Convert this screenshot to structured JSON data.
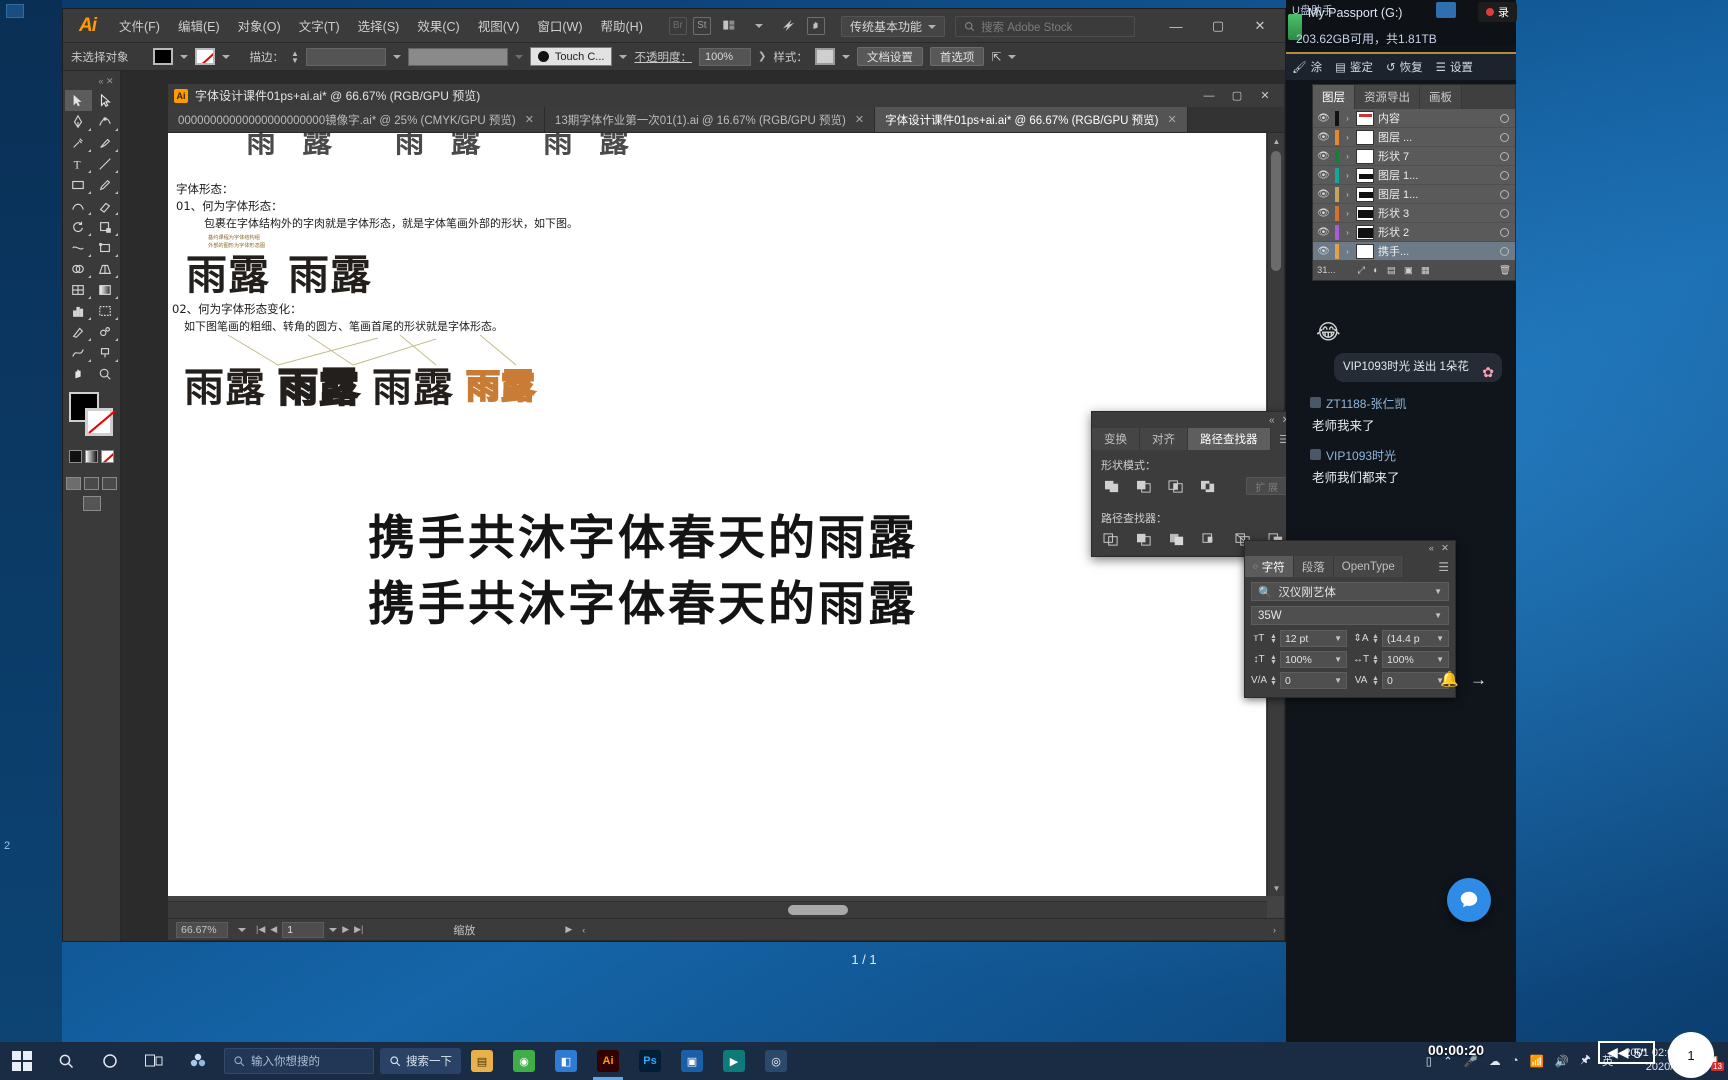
{
  "app": {
    "name": "Adobe Illustrator",
    "logo": "Ai",
    "menus": [
      "文件(F)",
      "编辑(E)",
      "对象(O)",
      "文字(T)",
      "选择(S)",
      "效果(C)",
      "视图(V)",
      "窗口(W)",
      "帮助(H)"
    ],
    "bridge_icon": "Br",
    "stock_icon": "St",
    "workspace": "传统基本功能",
    "search_placeholder": "搜索 Adobe Stock"
  },
  "control_bar": {
    "selection_status": "未选择对象",
    "stroke_label": "描边：",
    "brush_label": "Touch C...",
    "opacity_label": "不透明度：",
    "opacity_value": "100%",
    "style_label": "样式：",
    "doc_setup": "文档设置",
    "preferences": "首选项"
  },
  "document": {
    "title": "字体设计课件01ps+ai.ai* @ 66.67% (RGB/GPU 预览)",
    "tabs": [
      {
        "label": "00000000000000000000000镜像字.ai* @ 25% (CMYK/GPU 预览)",
        "active": false
      },
      {
        "label": "13期字体作业第一次01(1).ai @ 16.67% (RGB/GPU 预览)",
        "active": false
      },
      {
        "label": "字体设计课件01ps+ai.ai* @ 66.67% (RGB/GPU 预览)",
        "active": true
      }
    ],
    "status": {
      "zoom": "66.67%",
      "page": "1",
      "tool_name": "缩放"
    },
    "page_counter": "1 / 1"
  },
  "artboard": {
    "section1_title": "字体形态：",
    "section1_q": "01、何为字体形态：",
    "section1_a": "包裹在字体结构外的字肉就是字体形态，就是字体笔画外部的形状，如下图。",
    "sample_caption": "基约课程为字体结构组\n外部的图形为字体形态图",
    "sample1": "雨露",
    "sample2": "雨露",
    "section2_q": "02、何为字体形态变化：",
    "section2_a": "如下图笔画的粗细、转角的圆方、笔画首尾的形状就是字体形态。",
    "variants": [
      "雨露",
      "雨露",
      "雨露",
      "雨露"
    ],
    "headline1": "携手共沐字体春天的雨露",
    "headline2": "携手共沐字体春天的雨露"
  },
  "pathfinder_panel": {
    "tabs": [
      "变换",
      "对齐",
      "路径查找器"
    ],
    "active_tab": "路径查找器",
    "shape_modes_label": "形状模式：",
    "pathfinders_label": "路径查找器：",
    "expand_label": "扩 展"
  },
  "character_panel": {
    "tabs": [
      "字符",
      "段落",
      "OpenType"
    ],
    "active_tab": "字符",
    "font_family": "汉仪刚艺体",
    "font_style": "35W",
    "font_size": "12 pt",
    "leading": "(14.4 p",
    "vertical_scale": "100%",
    "horizontal_scale": "100%",
    "tracking": "0",
    "kerning": "0"
  },
  "layers_panel": {
    "tabs": [
      "图层",
      "资源导出",
      "画板"
    ],
    "active_tab": "图层",
    "rows": [
      {
        "name": "内容",
        "color": "#111111",
        "selected": false
      },
      {
        "name": "图层 ...",
        "color": "#e08a34",
        "selected": false
      },
      {
        "name": "形状 7",
        "color": "#1f7a3d",
        "selected": false
      },
      {
        "name": "图层 1...",
        "color": "#14a79a",
        "selected": false
      },
      {
        "name": "图层 1...",
        "color": "#c8a35a",
        "selected": false
      },
      {
        "name": "形状 3",
        "color": "#d4722c",
        "selected": false
      },
      {
        "name": "形状 2",
        "color": "#a95cd6",
        "selected": false
      },
      {
        "name": "携手...",
        "color": "#e3a24a",
        "selected": true
      }
    ],
    "footer_count": "31..."
  },
  "right_app": {
    "drive_title": "My Passport (G:)",
    "drive_info": "203.62GB可用，共1.81TB",
    "partial_label": "U盘助手",
    "tools": [
      "涂",
      "鉴定",
      "恢复",
      "设置"
    ],
    "tool_icons": [
      "brush-icon",
      "usb-icon",
      "restore-icon",
      "list-icon"
    ]
  },
  "chat": {
    "emoji": "😂",
    "gift": {
      "text": "VIP1093时光 送出 1朵花",
      "icon": "flower-icon"
    },
    "messages": [
      {
        "user": "ZT1188-张仁凯",
        "text": "老师我来了"
      },
      {
        "user": "VIP1093时光",
        "text": "老师我们都来了"
      }
    ]
  },
  "taskbar": {
    "search_placeholder": "输入你想搜的",
    "pill_label": "搜索一下",
    "apps": [
      {
        "name": "illustrator",
        "label": "Ai",
        "color": "#330000",
        "text_color": "#ff9a00",
        "active": true
      },
      {
        "name": "photoshop",
        "label": "Ps",
        "color": "#001e36",
        "text_color": "#31a8ff",
        "active": false
      },
      {
        "name": "media",
        "label": "▣",
        "color": "#1a5fa8",
        "text_color": "#ffffff",
        "active": false
      },
      {
        "name": "video",
        "label": "▶",
        "color": "#0e7a7a",
        "text_color": "#ffffff",
        "active": false
      },
      {
        "name": "browser",
        "label": "◎",
        "color": "#2b4a6b",
        "text_color": "#dfe8f2",
        "active": false
      }
    ],
    "clock_time": "2001 02:08:50",
    "clock_date": "2020/12/8",
    "input_method": "英",
    "badge_count": "13"
  },
  "recorder": {
    "elapsed": "00:00:20",
    "speed": "5\"",
    "speed_icon": "rewind-icon",
    "rec_label": "录"
  },
  "colors": {
    "accent_orange": "#ff9a00",
    "panel_bg": "#3c3c3c",
    "selection_blue": "#6d7b88",
    "taskbar_blue": "#1a2c44"
  }
}
